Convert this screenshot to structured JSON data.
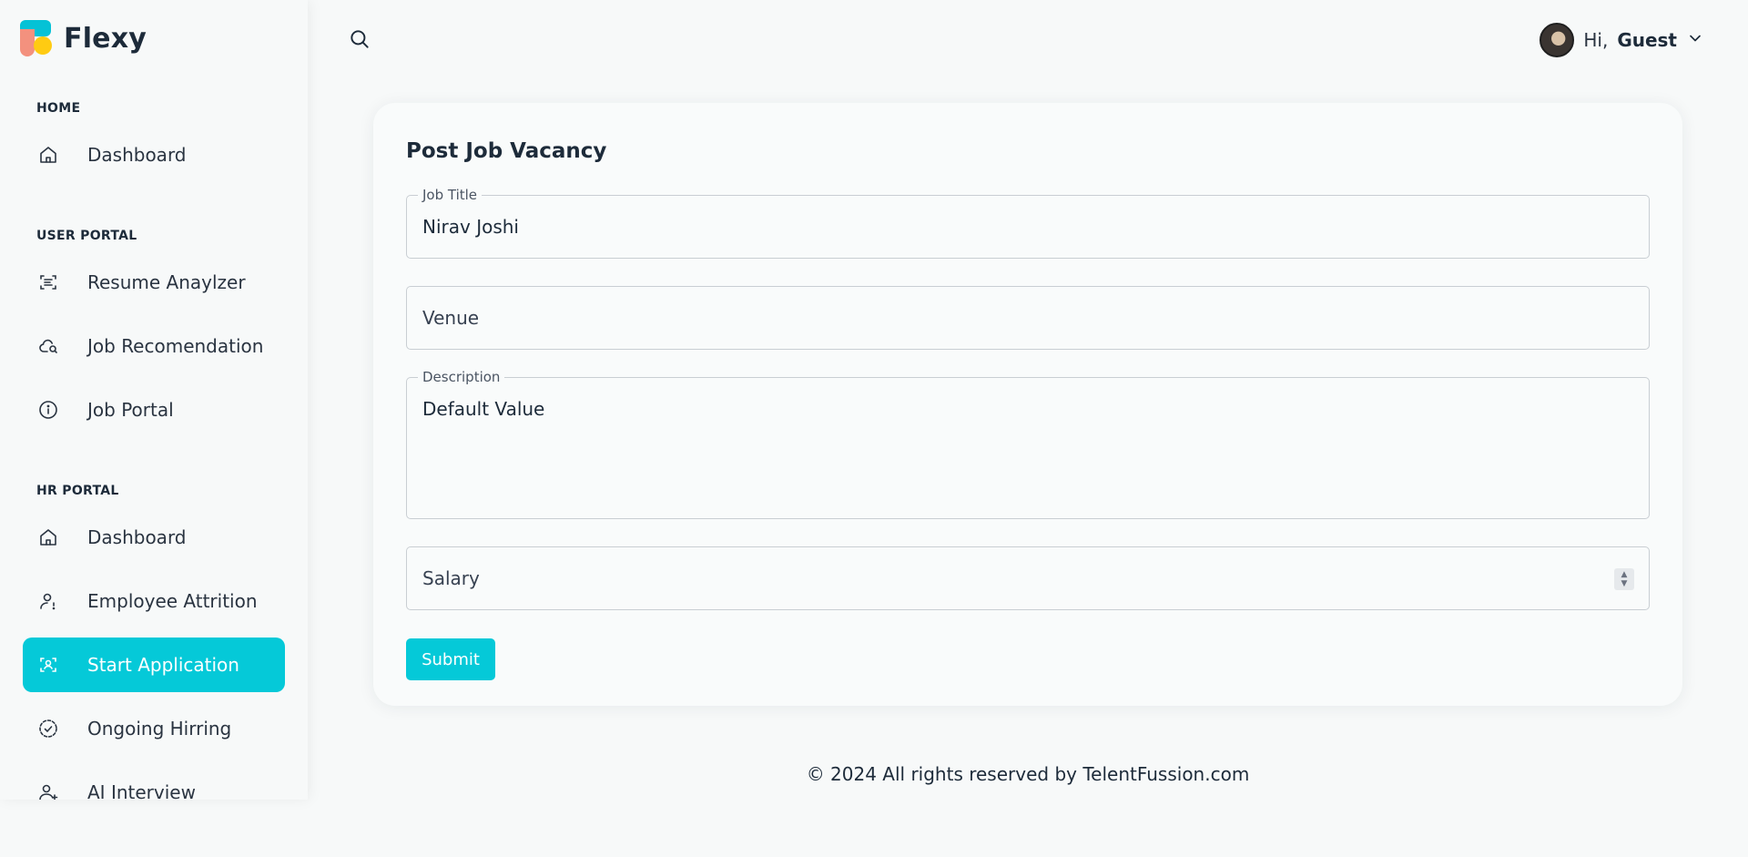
{
  "brand": {
    "name": "Flexy"
  },
  "sidebar": {
    "sections": [
      {
        "label": "HOME"
      },
      {
        "label": "USER PORTAL"
      },
      {
        "label": "HR PORTAL"
      }
    ],
    "items": [
      {
        "label": "Dashboard",
        "icon": "home-icon"
      },
      {
        "label": "Resume Anaylzer",
        "icon": "scan-text-icon"
      },
      {
        "label": "Job Recomendation",
        "icon": "cloud-search-icon"
      },
      {
        "label": "Job Portal",
        "icon": "info-icon"
      },
      {
        "label": "Dashboard",
        "icon": "home-icon"
      },
      {
        "label": "Employee Attrition",
        "icon": "user-alert-icon"
      },
      {
        "label": "Start Application",
        "icon": "scan-face-icon",
        "active": true
      },
      {
        "label": "Ongoing Hirring",
        "icon": "circle-check-icon"
      },
      {
        "label": "AI Interview",
        "icon": "user-plus-icon"
      }
    ]
  },
  "header": {
    "greeting": "Hi,",
    "user_name": "Guest"
  },
  "form": {
    "title": "Post Job Vacancy",
    "job_title": {
      "label": "Job Title",
      "value": "Nirav Joshi"
    },
    "venue": {
      "placeholder": "Venue"
    },
    "description": {
      "label": "Description",
      "value": "Default Value"
    },
    "salary": {
      "placeholder": "Salary"
    },
    "submit_label": "Submit"
  },
  "footer": {
    "text": "© 2024 All rights reserved by TelentFussion.com"
  },
  "colors": {
    "accent": "#05c9d8",
    "background": "#f7f9f9",
    "text": "#1d2b3a"
  }
}
